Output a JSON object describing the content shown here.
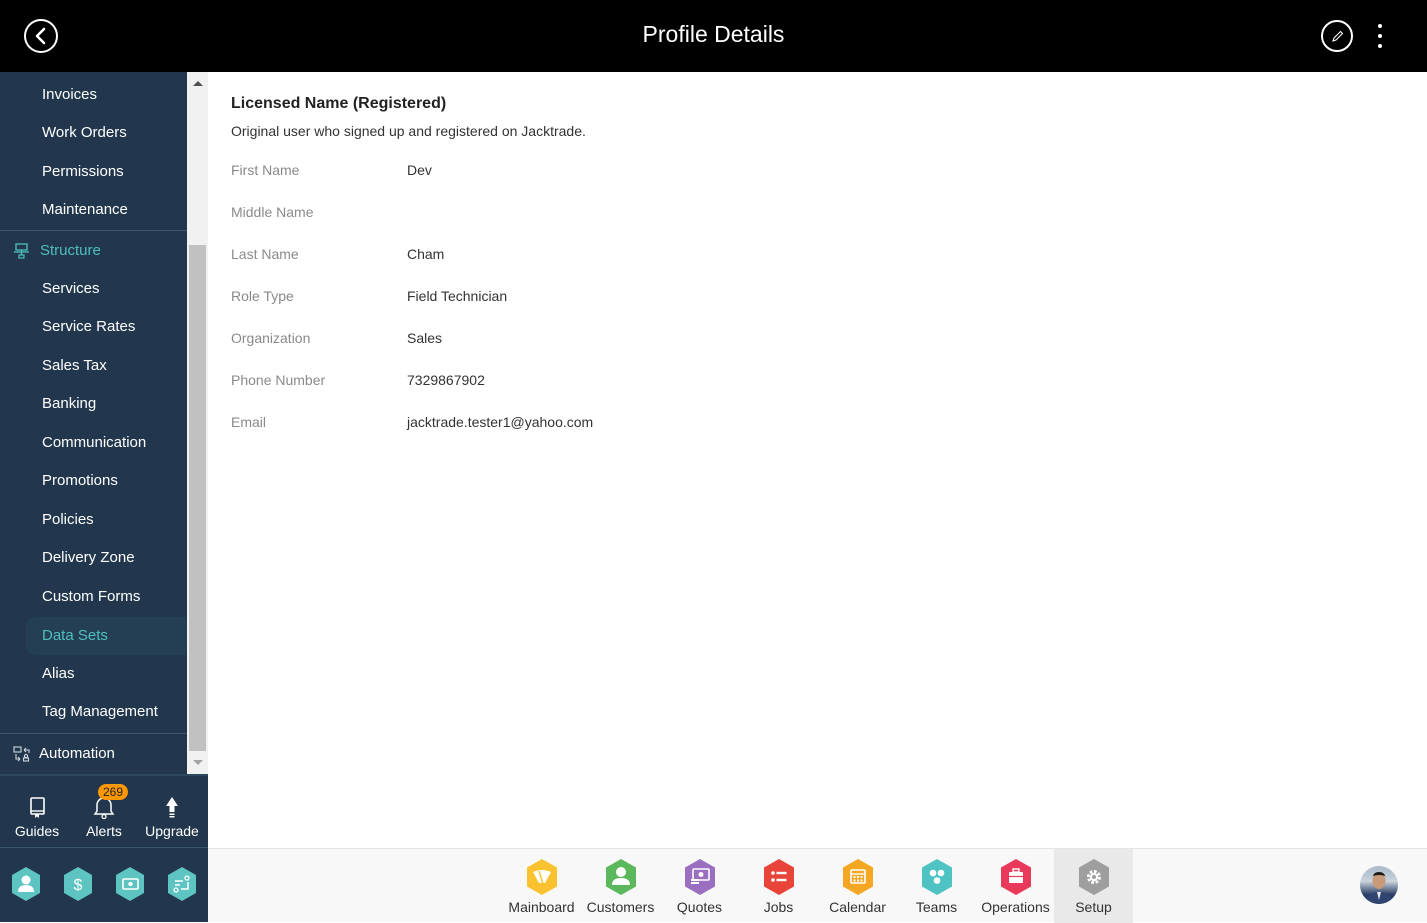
{
  "header": {
    "title": "Profile Details",
    "back_icon": "back-circle-icon",
    "edit_icon": "pencil-icon",
    "more_icon": "kebab-menu-icon"
  },
  "sidebar": {
    "items": [
      {
        "label": "Invoices",
        "type": "item"
      },
      {
        "label": "Work Orders",
        "type": "item"
      },
      {
        "label": "Permissions",
        "type": "item"
      },
      {
        "label": "Maintenance",
        "type": "item"
      },
      {
        "label": "Structure",
        "type": "section",
        "icon": "structure-icon"
      },
      {
        "label": "Services",
        "type": "item"
      },
      {
        "label": "Service Rates",
        "type": "item"
      },
      {
        "label": "Sales Tax",
        "type": "item"
      },
      {
        "label": "Banking",
        "type": "item"
      },
      {
        "label": "Communication",
        "type": "item"
      },
      {
        "label": "Promotions",
        "type": "item"
      },
      {
        "label": "Policies",
        "type": "item"
      },
      {
        "label": "Delivery Zone",
        "type": "item"
      },
      {
        "label": "Custom Forms",
        "type": "item"
      },
      {
        "label": "Data Sets",
        "type": "item",
        "active": true
      },
      {
        "label": "Alias",
        "type": "item"
      },
      {
        "label": "Tag Management",
        "type": "item"
      },
      {
        "label": "Automation",
        "type": "section",
        "icon": "automation-icon"
      }
    ],
    "quick": [
      {
        "label": "Guides",
        "icon": "book-icon"
      },
      {
        "label": "Alerts",
        "icon": "bell-icon",
        "badge": "269"
      },
      {
        "label": "Upgrade",
        "icon": "arrow-up-icon"
      }
    ],
    "hex_buttons": [
      {
        "icon": "user-icon"
      },
      {
        "icon": "dollar-icon"
      },
      {
        "icon": "money-icon"
      },
      {
        "icon": "workflow-icon"
      }
    ],
    "accent": "#4fbfbd",
    "background": "#22374d"
  },
  "profile": {
    "section_title": "Licensed Name (Registered)",
    "section_description": "Original user who signed up and registered on Jacktrade.",
    "fields": [
      {
        "label": "First Name",
        "value": "Dev"
      },
      {
        "label": "Middle Name",
        "value": ""
      },
      {
        "label": "Last Name",
        "value": "Cham"
      },
      {
        "label": "Role Type",
        "value": "Field Technician"
      },
      {
        "label": "Organization",
        "value": "Sales"
      },
      {
        "label": "Phone Number",
        "value": "7329867902"
      },
      {
        "label": "Email",
        "value": "jacktrade.tester1@yahoo.com"
      }
    ]
  },
  "bottom_nav": {
    "apps": [
      {
        "label": "Mainboard",
        "icon": "mainboard-icon",
        "color": "#f9c22e"
      },
      {
        "label": "Customers",
        "icon": "customer-icon",
        "color": "#5cb85c"
      },
      {
        "label": "Quotes",
        "icon": "quotes-icon",
        "color": "#9b6fc0"
      },
      {
        "label": "Jobs",
        "icon": "jobs-icon",
        "color": "#e8443a"
      },
      {
        "label": "Calendar",
        "icon": "calendar-icon",
        "color": "#f5a623"
      },
      {
        "label": "Teams",
        "icon": "teams-icon",
        "color": "#4fc3c3"
      },
      {
        "label": "Operations",
        "icon": "operations-icon",
        "color": "#e8395a"
      },
      {
        "label": "Setup",
        "icon": "gear-icon",
        "color": "#9e9e9e",
        "active": true
      }
    ],
    "avatar": "user-avatar"
  }
}
